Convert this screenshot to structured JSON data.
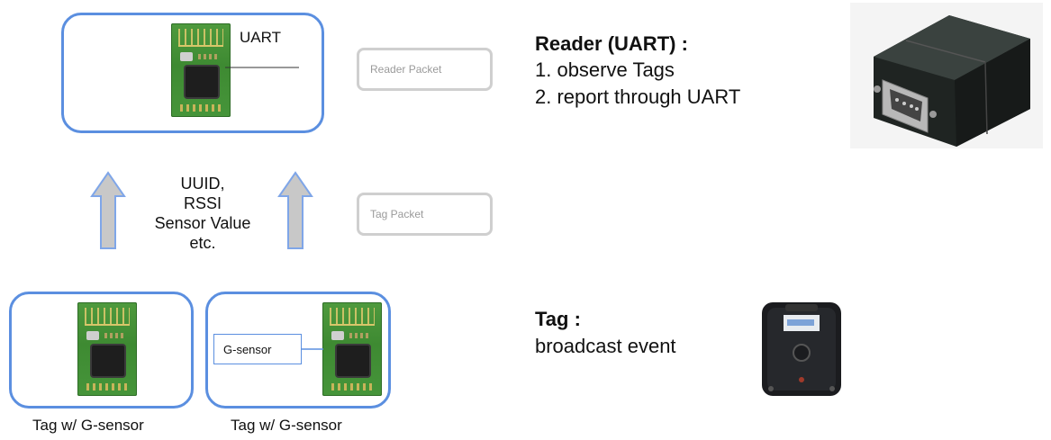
{
  "reader_box": {
    "label": "UART"
  },
  "packets": {
    "reader_packet": "Reader Packet",
    "tag_packet": "Tag Packet"
  },
  "annotation": {
    "lines": [
      "UUID,",
      "RSSI",
      "Sensor Value",
      "etc."
    ]
  },
  "tags": {
    "left_caption": "Tag w/ G-sensor",
    "right_caption": "Tag w/ G-sensor",
    "gsensor_label": "G-sensor"
  },
  "reader_description": {
    "title": "Reader (UART) :",
    "items": [
      "1. observe Tags",
      "2. report through UART"
    ]
  },
  "tag_description": {
    "title": "Tag :",
    "text": "broadcast event"
  },
  "colors": {
    "box_border": "#5b8fe0",
    "packet_border": "#cfcfcf",
    "arrow_fill": "#c8c8c8",
    "arrow_stroke": "#7fa6e8"
  }
}
